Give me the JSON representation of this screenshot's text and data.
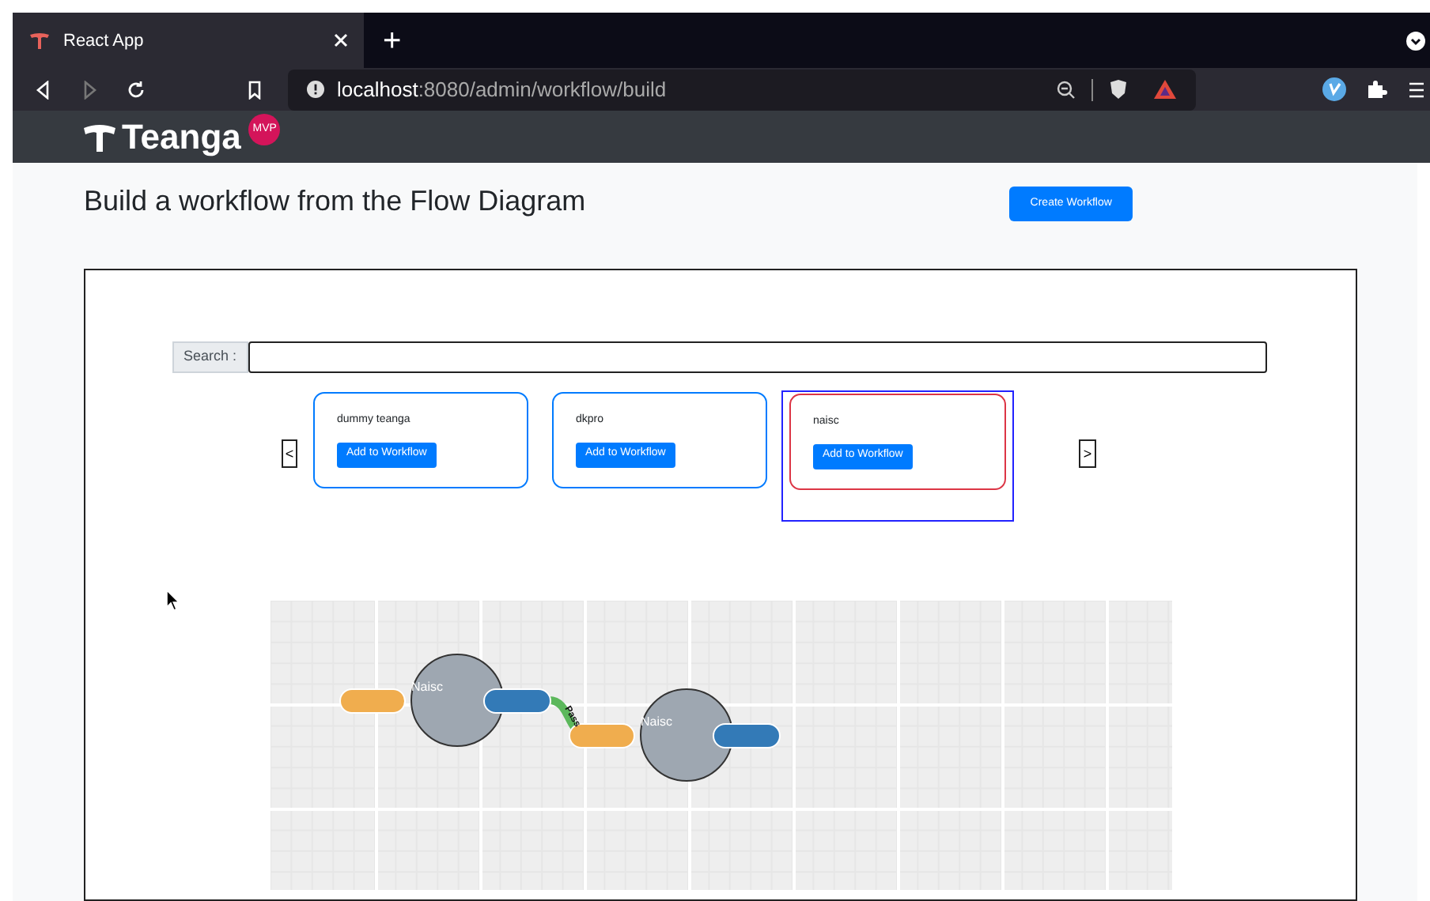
{
  "browser": {
    "tab_title": "React App",
    "new_tab": "+",
    "url_host": "localhost",
    "url_path": ":8080/admin/workflow/build"
  },
  "header": {
    "brand": "Teanga",
    "badge": "MVP"
  },
  "page": {
    "title": "Build a workflow from the Flow Diagram",
    "create_button": "Create Workflow"
  },
  "search": {
    "label": "Search :"
  },
  "carousel": {
    "prev": "<",
    "next": ">",
    "cards": [
      {
        "name": "dummy teanga",
        "button": "Add to Workflow",
        "selected": false
      },
      {
        "name": "dkpro",
        "button": "Add to Workflow",
        "selected": false
      },
      {
        "name": "naisc",
        "button": "Add to Workflow",
        "selected": true
      }
    ]
  },
  "diagram": {
    "nodes": [
      {
        "label": "Naisc"
      },
      {
        "label": "Naisc"
      }
    ],
    "edges": [
      {
        "label": "Pass"
      }
    ]
  }
}
